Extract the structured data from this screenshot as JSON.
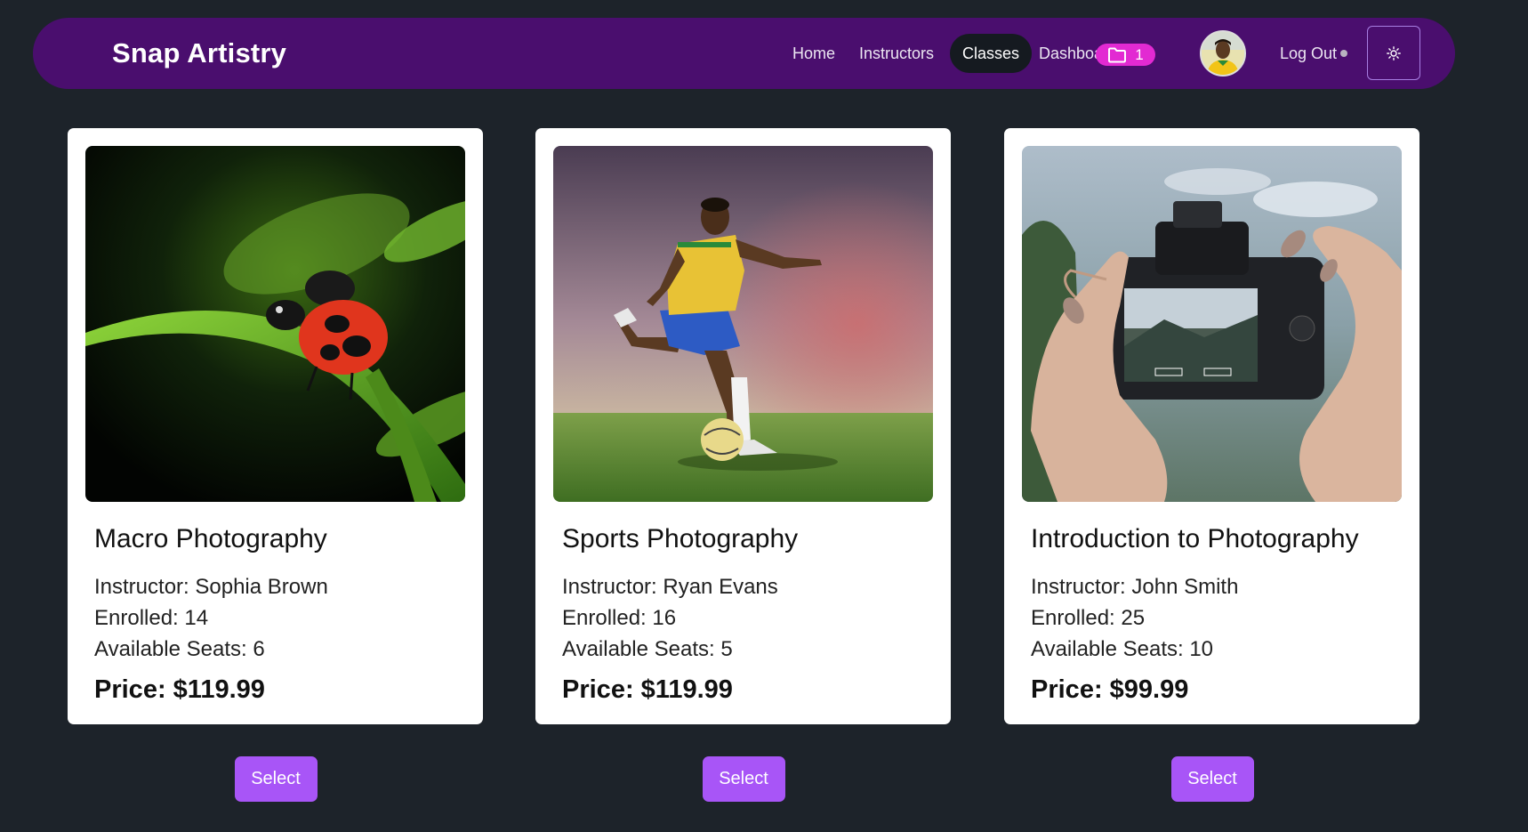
{
  "brand": "Snap Artistry",
  "nav": {
    "home": "Home",
    "instructors": "Instructors",
    "classes": "Classes",
    "dashboard": "Dashboard",
    "cart_count": "1",
    "logout": "Log Out"
  },
  "colors": {
    "navbar": "#4a0e6e",
    "background": "#1d232a",
    "badge": "#e22ad2",
    "select_button": "#a855f7"
  },
  "classes": [
    {
      "image": "ladybug-macro-photo",
      "title": "Macro Photography",
      "instructor": "Instructor: Sophia Brown",
      "enrolled": "Enrolled: 14",
      "seats": "Available Seats: 6",
      "price": "Price: $119.99",
      "button": "Select"
    },
    {
      "image": "soccer-player-photo",
      "title": "Sports Photography",
      "instructor": "Instructor: Ryan Evans",
      "enrolled": "Enrolled: 16",
      "seats": "Available Seats: 5",
      "price": "Price: $119.99",
      "button": "Select"
    },
    {
      "image": "hands-holding-camera-photo",
      "title": "Introduction to Photography",
      "instructor": "Instructor: John Smith",
      "enrolled": "Enrolled: 25",
      "seats": "Available Seats: 10",
      "price": "Price: $99.99",
      "button": "Select"
    }
  ]
}
